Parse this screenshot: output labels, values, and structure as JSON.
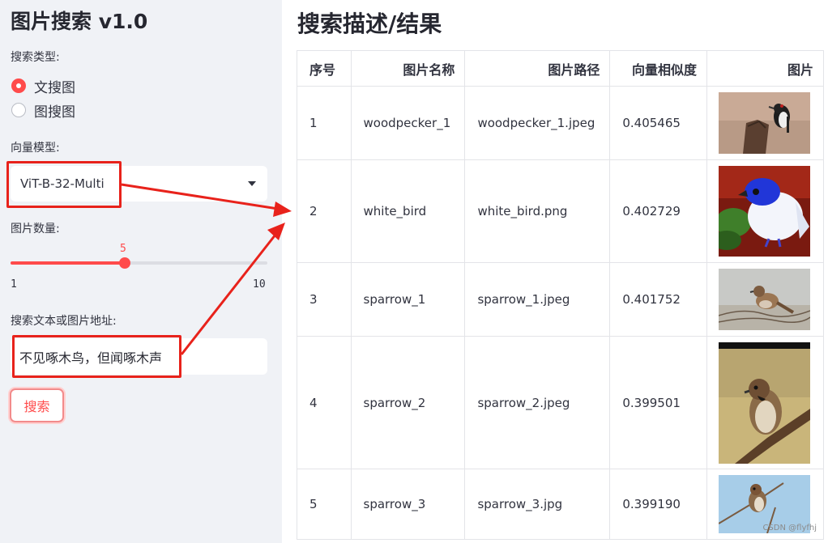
{
  "sidebar": {
    "title": "图片搜索 v1.0",
    "search_type_label": "搜索类型:",
    "search_type_options": [
      "文搜图",
      "图搜图"
    ],
    "search_type_selected": "文搜图",
    "model_label": "向量模型:",
    "model_value": "ViT-B-32-Multi",
    "count_label": "图片数量:",
    "count_value": "5",
    "count_min": "1",
    "count_max": "10",
    "query_label": "搜索文本或图片地址:",
    "query_value": "不见啄木鸟，但闻啄木声",
    "search_button": "搜索"
  },
  "main": {
    "title": "搜索描述/结果",
    "columns": [
      "序号",
      "图片名称",
      "图片路径",
      "向量相似度",
      "图片"
    ],
    "rows": [
      {
        "index": "1",
        "name": "woodpecker_1",
        "path": "woodpecker_1.jpeg",
        "score": "0.405465",
        "image": "woodpecker-photo"
      },
      {
        "index": "2",
        "name": "white_bird",
        "path": "white_bird.png",
        "score": "0.402729",
        "image": "blue-white-bird-photo"
      },
      {
        "index": "3",
        "name": "sparrow_1",
        "path": "sparrow_1.jpeg",
        "score": "0.401752",
        "image": "sparrow-on-wire-photo"
      },
      {
        "index": "4",
        "name": "sparrow_2",
        "path": "sparrow_2.jpeg",
        "score": "0.399501",
        "image": "sparrow-on-branch-photo"
      },
      {
        "index": "5",
        "name": "sparrow_3",
        "path": "sparrow_3.jpg",
        "score": "0.399190",
        "image": "sparrow-sky-photo"
      }
    ]
  },
  "watermark": "CSDN @flyfhj",
  "colors": {
    "accent": "#ff4b4b",
    "annotation_red": "#e8221b",
    "sidebar_bg": "#f0f2f6"
  }
}
